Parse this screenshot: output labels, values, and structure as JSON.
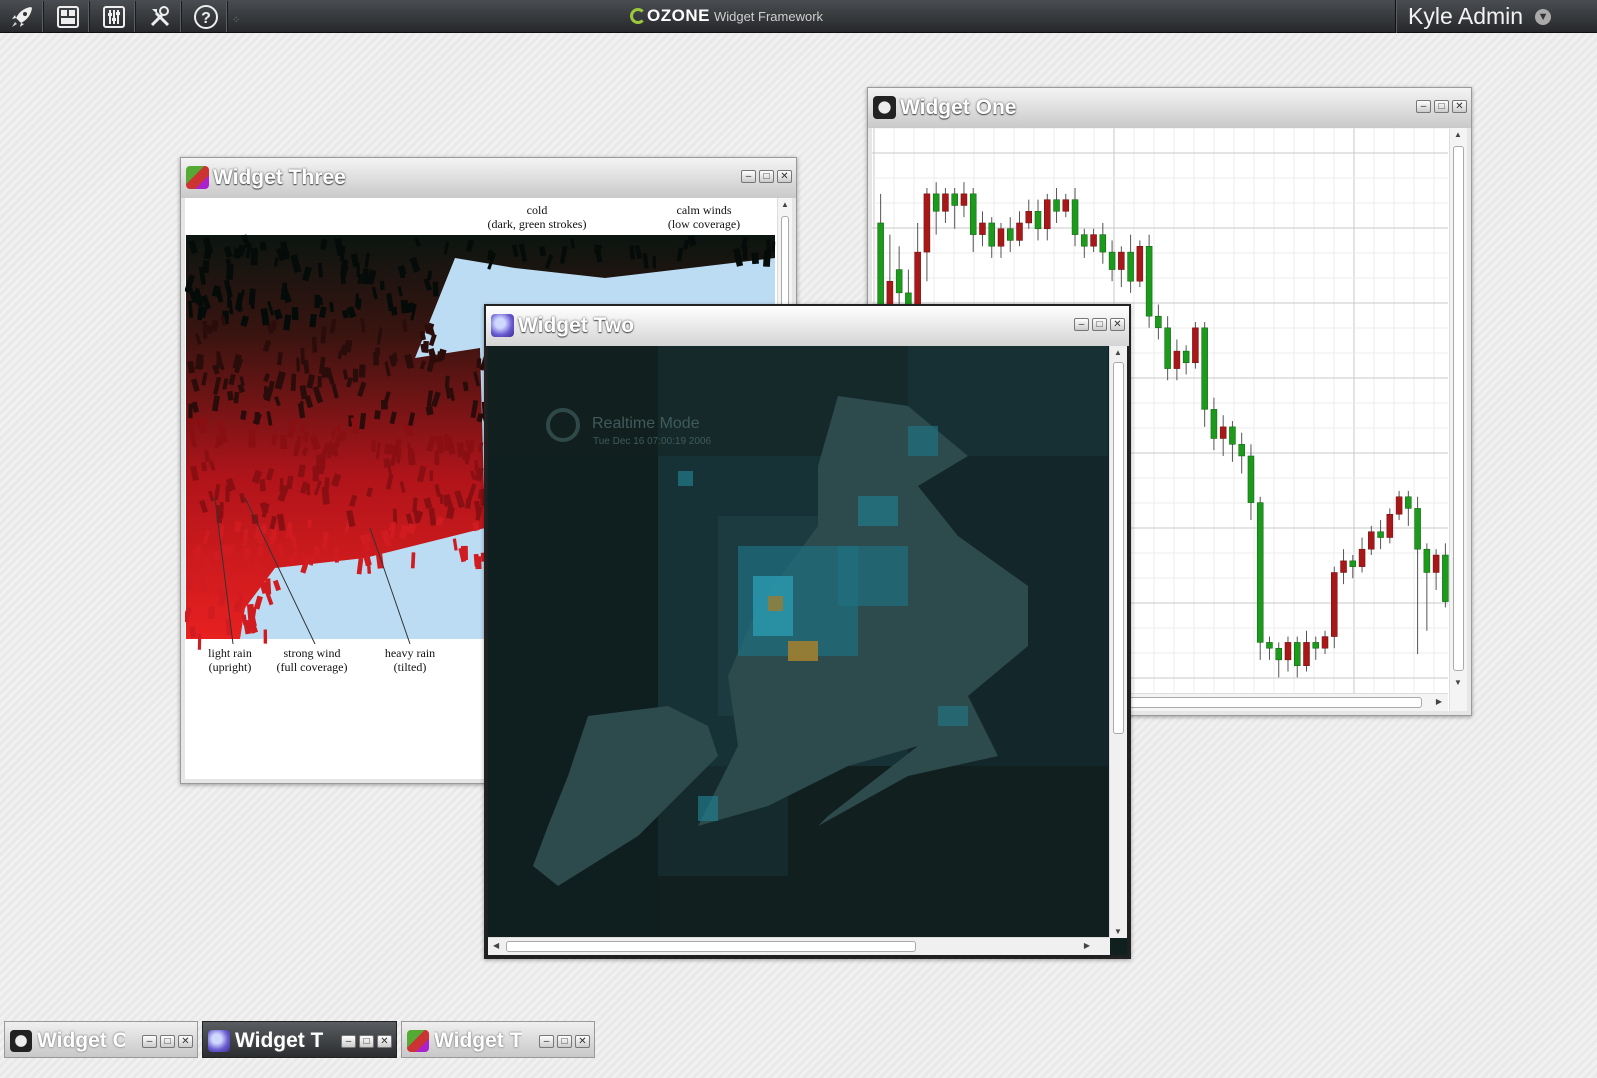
{
  "topbar": {
    "buttons": [
      "launch-icon",
      "dashboard-icon",
      "settings-sliders-icon",
      "admin-tools-icon",
      "help-icon"
    ],
    "brand_name": "OZONE",
    "brand_sub": "Widget Framework",
    "user_name": "Kyle Admin"
  },
  "windows": {
    "three": {
      "title": "Widget Three",
      "labels": {
        "cold": "cold",
        "cold_sub": "(dark, green strokes)",
        "calm": "calm winds",
        "calm_sub": "(low coverage)",
        "light_rain": "light rain",
        "light_rain_sub": "(upright)",
        "strong_wind": "strong wind",
        "strong_wind_sub": "(full coverage)",
        "heavy_rain": "heavy rain",
        "heavy_rain_sub": "(tilted)"
      }
    },
    "one": {
      "title": "Widget One"
    },
    "two": {
      "title": "Widget Two",
      "mode_label": "Realtime Mode",
      "timestamp": "Tue Dec 16 07:00:19 2006"
    }
  },
  "taskbar": [
    {
      "label": "Widget One",
      "visible_label": "Widget C",
      "active": false
    },
    {
      "label": "Widget Two",
      "visible_label": "Widget T",
      "active": true
    },
    {
      "label": "Widget Three",
      "visible_label": "Widget T",
      "active": false
    }
  ],
  "controls": {
    "minimize": "–",
    "maximize": "□",
    "close": "✕"
  },
  "chart_data": {
    "type": "candlestick",
    "title": "",
    "candles": [
      [
        90,
        70,
        95,
        65
      ],
      [
        72,
        80,
        88,
        70
      ],
      [
        82,
        78,
        86,
        74
      ],
      [
        78,
        72,
        82,
        68
      ],
      [
        72,
        85,
        90,
        64
      ],
      [
        85,
        95,
        96,
        80
      ],
      [
        95,
        92,
        97,
        88
      ],
      [
        92,
        95,
        96,
        90
      ],
      [
        95,
        93,
        96,
        89
      ],
      [
        93,
        95,
        97,
        91
      ],
      [
        95,
        88,
        96,
        85
      ],
      [
        88,
        90,
        92,
        86
      ],
      [
        90,
        86,
        91,
        84
      ],
      [
        86,
        89,
        90,
        84
      ],
      [
        89,
        87,
        91,
        85
      ],
      [
        87,
        90,
        92,
        86
      ],
      [
        90,
        92,
        94,
        89
      ],
      [
        92,
        89,
        94,
        87
      ],
      [
        89,
        94,
        95,
        87
      ],
      [
        94,
        92,
        96,
        90
      ],
      [
        92,
        94,
        95,
        91
      ],
      [
        94,
        88,
        96,
        86
      ],
      [
        88,
        86,
        89,
        84
      ],
      [
        86,
        88,
        89,
        85
      ],
      [
        88,
        85,
        90,
        83
      ],
      [
        85,
        82,
        87,
        80
      ],
      [
        82,
        85,
        86,
        79
      ],
      [
        85,
        80,
        88,
        78
      ],
      [
        80,
        86,
        87,
        79
      ],
      [
        86,
        74,
        88,
        72
      ],
      [
        74,
        72,
        76,
        70
      ],
      [
        72,
        65,
        74,
        63
      ],
      [
        65,
        68,
        70,
        63
      ],
      [
        68,
        66,
        69,
        64
      ],
      [
        66,
        72,
        73,
        65
      ],
      [
        72,
        58,
        73,
        55
      ],
      [
        58,
        53,
        60,
        51
      ],
      [
        53,
        55,
        57,
        50
      ],
      [
        55,
        52,
        56,
        49
      ],
      [
        52,
        50,
        54,
        47
      ],
      [
        50,
        42,
        52,
        39
      ],
      [
        42,
        18,
        43,
        15
      ],
      [
        18,
        17,
        19,
        15
      ],
      [
        17,
        15,
        18,
        12
      ],
      [
        15,
        18,
        19,
        13
      ],
      [
        18,
        14,
        19,
        12
      ],
      [
        14,
        18,
        20,
        13
      ],
      [
        18,
        17,
        19,
        15
      ],
      [
        17,
        19,
        20,
        16
      ],
      [
        19,
        30,
        31,
        17
      ],
      [
        30,
        32,
        34,
        28
      ],
      [
        32,
        31,
        33,
        29
      ],
      [
        31,
        34,
        36,
        30
      ],
      [
        34,
        37,
        38,
        33
      ],
      [
        37,
        36,
        39,
        34
      ],
      [
        36,
        40,
        41,
        35
      ],
      [
        40,
        43,
        44,
        39
      ],
      [
        43,
        41,
        44,
        38
      ],
      [
        41,
        34,
        43,
        16
      ],
      [
        34,
        30,
        35,
        20
      ],
      [
        30,
        33,
        34,
        27
      ],
      [
        33,
        25,
        35,
        24
      ]
    ],
    "y_range": [
      10,
      100
    ],
    "grid": true
  }
}
